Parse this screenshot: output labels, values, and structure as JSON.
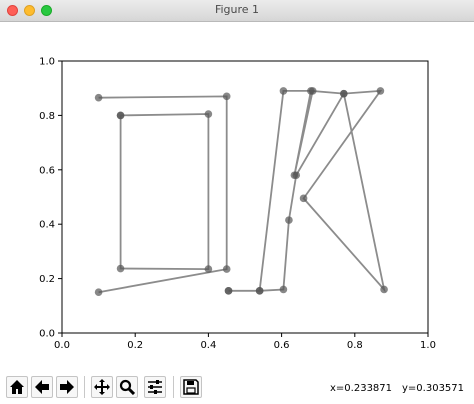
{
  "window": {
    "title": "Figure 1"
  },
  "chart_data": {
    "type": "line",
    "series": [
      {
        "x": [
          0.1,
          0.45,
          0.45,
          0.1
        ],
        "y": [
          0.865,
          0.87,
          0.235,
          0.15
        ]
      },
      {
        "x": [
          0.16,
          0.4,
          0.4,
          0.16,
          0.16
        ],
        "y": [
          0.8,
          0.805,
          0.235,
          0.237,
          0.8
        ]
      },
      {
        "x": [
          0.455,
          0.54,
          0.605,
          0.62,
          0.64,
          0.77,
          0.88,
          0.66,
          0.87,
          0.77,
          0.68,
          0.635,
          0.685,
          0.605,
          0.54,
          0.455
        ],
        "y": [
          0.155,
          0.155,
          0.16,
          0.415,
          0.58,
          0.88,
          0.16,
          0.495,
          0.89,
          0.88,
          0.89,
          0.58,
          0.89,
          0.89,
          0.155,
          0.155
        ]
      }
    ],
    "xlim": [
      0.0,
      1.0
    ],
    "ylim": [
      0.0,
      1.0
    ],
    "xticks": [
      "0.0",
      "0.2",
      "0.4",
      "0.6",
      "0.8",
      "1.0"
    ],
    "yticks": [
      "0.0",
      "0.2",
      "0.4",
      "0.6",
      "0.8",
      "1.0"
    ],
    "line_color": "#808080",
    "marker_color": "#555555",
    "grid": false
  },
  "toolbar": {
    "buttons": [
      "home-icon",
      "back-icon",
      "forward-icon",
      "pan-icon",
      "zoom-icon",
      "configure-icon",
      "save-icon"
    ]
  },
  "status": {
    "x_readout": "x=0.233871",
    "y_readout": "y=0.303571"
  }
}
